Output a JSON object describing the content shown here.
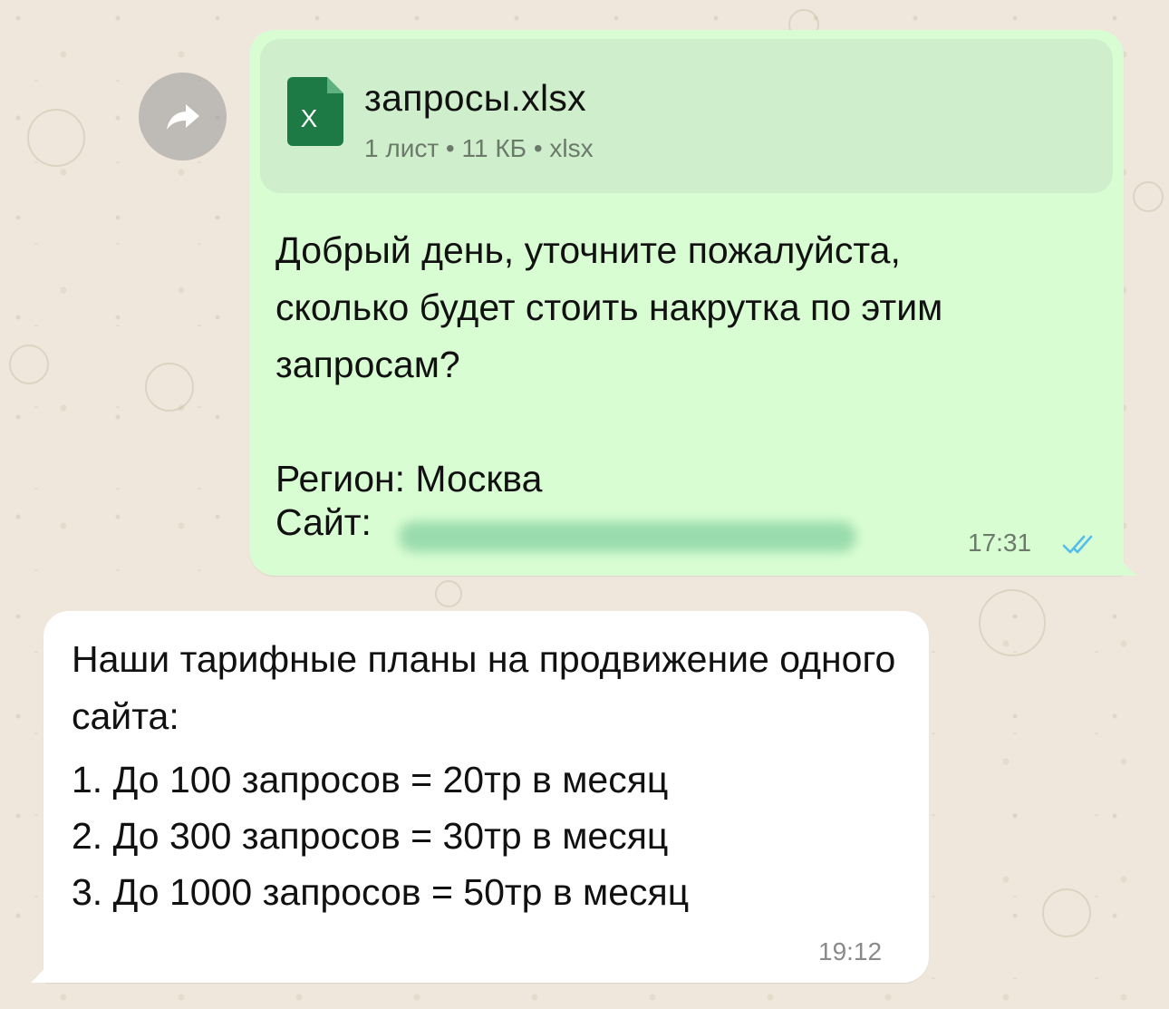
{
  "outgoing": {
    "file": {
      "icon": "xlsx-file-icon",
      "icon_letter": "X",
      "name": "запросы.xlsx",
      "meta": "1 лист • 11 КБ • xlsx"
    },
    "text": "Добрый день, уточните пожалуйста,\nсколько будет стоить накрутка по этим\nзапросам?\n\nРегион: Москва",
    "site_label": "Сайт:",
    "time": "17:31",
    "status": "read",
    "tick_color": "#53bdeb"
  },
  "incoming": {
    "intro": "Наши тарифные планы на продвижение одного сайта:",
    "plans": [
      "1. До 100 запросов = 20тр в месяц",
      "2. До 300 запросов = 30тр в месяц",
      "3. До 1000 запросов = 50тр в месяц"
    ],
    "time": "19:12"
  },
  "colors": {
    "outgoing_bubble": "#d9fdd3",
    "incoming_bubble": "#ffffff",
    "excel_green": "#1d7a45"
  }
}
